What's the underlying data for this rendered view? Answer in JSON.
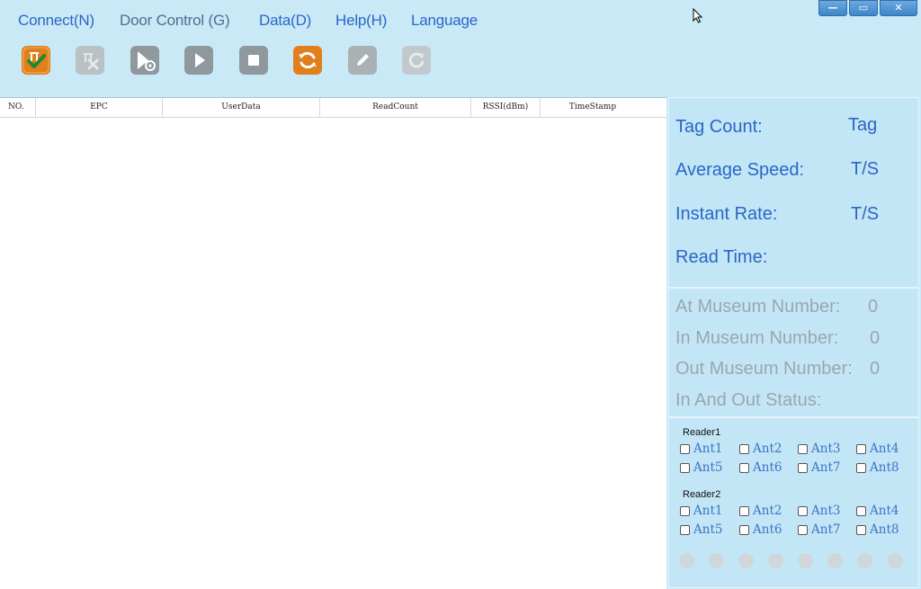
{
  "menu": {
    "connect": "Connect(N)",
    "door_control": "Door Control (G)",
    "data": "Data(D)",
    "help": "Help(H)",
    "language": "Language"
  },
  "window_controls": {
    "minimize": "—",
    "maximize": "▭",
    "close": "✕"
  },
  "toolbar": {
    "icons": [
      "connect-check-icon",
      "disconnect-icon",
      "start-settings-icon",
      "play-icon",
      "stop-icon",
      "refresh-icon",
      "edit-icon",
      "reset-icon"
    ],
    "colors": {
      "active": "#e07f1c",
      "disabled": "#a9b1b5",
      "enabled": "#8f989d"
    }
  },
  "table": {
    "columns": [
      "NO.",
      "EPC",
      "UserData",
      "ReadCount",
      "RSSI(dBm)",
      "TimeStamp"
    ],
    "rows": []
  },
  "stats": {
    "tag_count_label": "Tag Count:",
    "tag_count_unit": "Tag",
    "average_speed_label": "Average Speed:",
    "average_speed_unit": "T/S",
    "instant_rate_label": "Instant Rate:",
    "instant_rate_unit": "T/S",
    "read_time_label": "Read Time:"
  },
  "museum": {
    "at_label": "At  Museum  Number:",
    "at_value": "0",
    "in_label": "In  Museum   Number:",
    "in_value": "0",
    "out_label": "Out Museum Number:",
    "out_value": "0",
    "status_label": "In And Out Status:"
  },
  "readers": [
    {
      "title": "Reader1",
      "antennas": [
        "Ant1",
        "Ant2",
        "Ant3",
        "Ant4",
        "Ant5",
        "Ant6",
        "Ant7",
        "Ant8"
      ]
    },
    {
      "title": "Reader2",
      "antennas": [
        "Ant1",
        "Ant2",
        "Ant3",
        "Ant4",
        "Ant5",
        "Ant6",
        "Ant7",
        "Ant8"
      ]
    }
  ],
  "status_leds": {
    "count": 8,
    "color": "#cfd7db"
  },
  "colors": {
    "background": "#c9e9f7",
    "menu_text": "#2a66c8",
    "menu_text_dim": "#4d6f8f",
    "stat_text": "#2a66c8",
    "museum_text": "#9aa7ae",
    "antenna_text": "#3b74c6"
  }
}
